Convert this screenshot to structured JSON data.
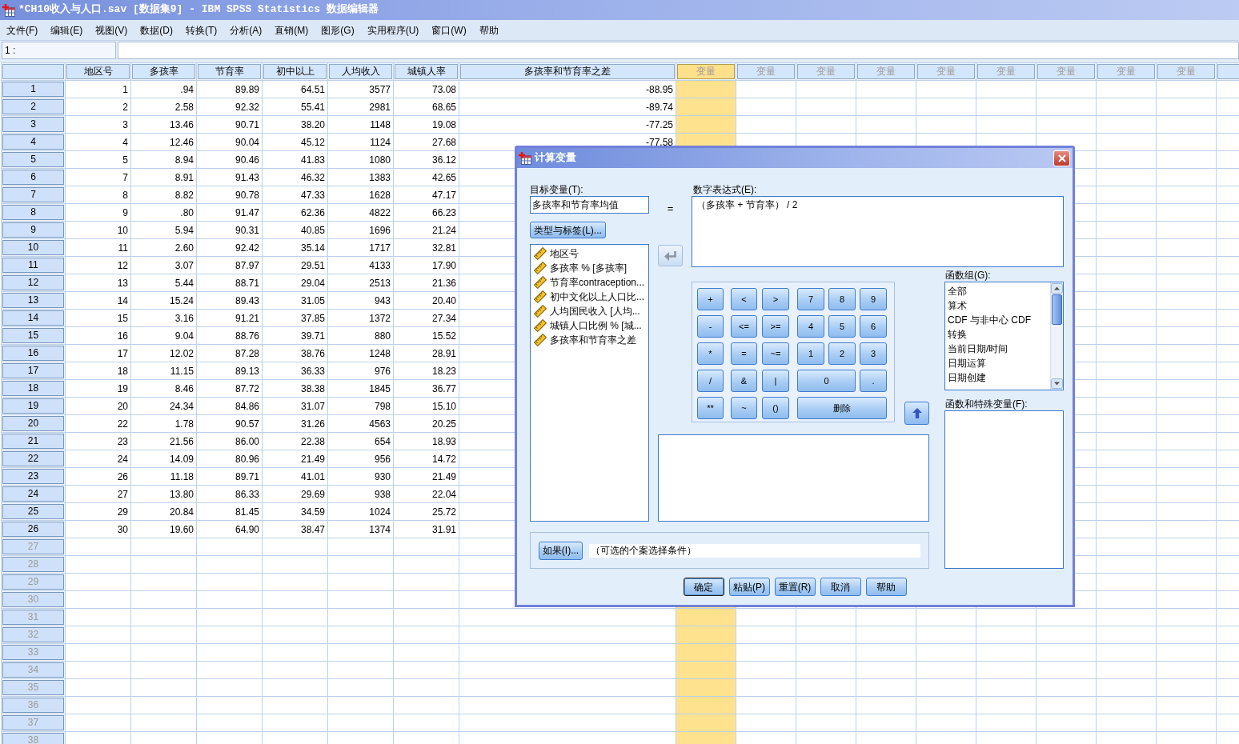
{
  "window": {
    "title": "*CH10收入与人口.sav [数据集9] - IBM SPSS Statistics 数据编辑器"
  },
  "menu": [
    "文件(F)",
    "编辑(E)",
    "视图(V)",
    "数据(D)",
    "转换(T)",
    "分析(A)",
    "直销(M)",
    "图形(G)",
    "实用程序(U)",
    "窗口(W)",
    "帮助"
  ],
  "cell_editor": {
    "reference": "1 :"
  },
  "grid": {
    "columns": [
      {
        "label": "地区号",
        "kind": "variable",
        "selected": false
      },
      {
        "label": "多孩率",
        "kind": "variable",
        "selected": false
      },
      {
        "label": "节育率",
        "kind": "variable",
        "selected": false
      },
      {
        "label": "初中以上",
        "kind": "variable",
        "selected": false
      },
      {
        "label": "人均收入",
        "kind": "variable",
        "selected": false
      },
      {
        "label": "城镇人率",
        "kind": "variable",
        "selected": false
      },
      {
        "label": "多孩率和节育率之差",
        "kind": "variable",
        "selected": false
      },
      {
        "label": "变量",
        "kind": "empty",
        "selected": true
      },
      {
        "label": "变量",
        "kind": "empty",
        "selected": false
      },
      {
        "label": "变量",
        "kind": "empty",
        "selected": false
      },
      {
        "label": "变量",
        "kind": "empty",
        "selected": false
      },
      {
        "label": "变量",
        "kind": "empty",
        "selected": false
      },
      {
        "label": "变量",
        "kind": "empty",
        "selected": false
      },
      {
        "label": "变量",
        "kind": "empty",
        "selected": false
      },
      {
        "label": "变量",
        "kind": "empty",
        "selected": false
      },
      {
        "label": "变量",
        "kind": "empty",
        "selected": false
      },
      {
        "kind": "empty",
        "selected": false
      }
    ],
    "rows": [
      {
        "number": "1",
        "cells": [
          "1",
          ".94",
          "89.89",
          "64.51",
          "3577",
          "73.08",
          "-88.95"
        ]
      },
      {
        "number": "2",
        "cells": [
          "2",
          "2.58",
          "92.32",
          "55.41",
          "2981",
          "68.65",
          "-89.74"
        ]
      },
      {
        "number": "3",
        "cells": [
          "3",
          "13.46",
          "90.71",
          "38.20",
          "1148",
          "19.08",
          "-77.25"
        ]
      },
      {
        "number": "4",
        "cells": [
          "4",
          "12.46",
          "90.04",
          "45.12",
          "1124",
          "27.68",
          "-77.58"
        ]
      },
      {
        "number": "5",
        "cells": [
          "5",
          "8.94",
          "90.46",
          "41.83",
          "1080",
          "36.12"
        ]
      },
      {
        "number": "6",
        "cells": [
          "7",
          "8.91",
          "91.43",
          "46.32",
          "1383",
          "42.65"
        ]
      },
      {
        "number": "7",
        "cells": [
          "8",
          "8.82",
          "90.78",
          "47.33",
          "1628",
          "47.17"
        ]
      },
      {
        "number": "8",
        "cells": [
          "9",
          ".80",
          "91.47",
          "62.36",
          "4822",
          "66.23"
        ]
      },
      {
        "number": "9",
        "cells": [
          "10",
          "5.94",
          "90.31",
          "40.85",
          "1696",
          "21.24"
        ]
      },
      {
        "number": "10",
        "cells": [
          "11",
          "2.60",
          "92.42",
          "35.14",
          "1717",
          "32.81"
        ]
      },
      {
        "number": "11",
        "cells": [
          "12",
          "3.07",
          "87.97",
          "29.51",
          "4133",
          "17.90"
        ]
      },
      {
        "number": "12",
        "cells": [
          "13",
          "5.44",
          "88.71",
          "29.04",
          "2513",
          "21.36"
        ]
      },
      {
        "number": "13",
        "cells": [
          "14",
          "15.24",
          "89.43",
          "31.05",
          "943",
          "20.40"
        ]
      },
      {
        "number": "14",
        "cells": [
          "15",
          "3.16",
          "91.21",
          "37.85",
          "1372",
          "27.34"
        ]
      },
      {
        "number": "15",
        "cells": [
          "16",
          "9.04",
          "88.76",
          "39.71",
          "880",
          "15.52"
        ]
      },
      {
        "number": "16",
        "cells": [
          "17",
          "12.02",
          "87.28",
          "38.76",
          "1248",
          "28.91"
        ]
      },
      {
        "number": "17",
        "cells": [
          "18",
          "11.15",
          "89.13",
          "36.33",
          "976",
          "18.23"
        ]
      },
      {
        "number": "18",
        "cells": [
          "19",
          "8.46",
          "87.72",
          "38.38",
          "1845",
          "36.77"
        ]
      },
      {
        "number": "19",
        "cells": [
          "20",
          "24.34",
          "84.86",
          "31.07",
          "798",
          "15.10"
        ]
      },
      {
        "number": "20",
        "cells": [
          "22",
          "1.78",
          "90.57",
          "31.26",
          "4563",
          "20.25"
        ]
      },
      {
        "number": "21",
        "cells": [
          "23",
          "21.56",
          "86.00",
          "22.38",
          "654",
          "18.93"
        ]
      },
      {
        "number": "22",
        "cells": [
          "24",
          "14.09",
          "80.96",
          "21.49",
          "956",
          "14.72"
        ]
      },
      {
        "number": "23",
        "cells": [
          "26",
          "11.18",
          "89.71",
          "41.01",
          "930",
          "21.49"
        ]
      },
      {
        "number": "24",
        "cells": [
          "27",
          "13.80",
          "86.33",
          "29.69",
          "938",
          "22.04"
        ]
      },
      {
        "number": "25",
        "cells": [
          "29",
          "20.84",
          "81.45",
          "34.59",
          "1024",
          "25.72"
        ]
      },
      {
        "number": "26",
        "cells": [
          "30",
          "19.60",
          "64.90",
          "38.47",
          "1374",
          "31.91"
        ]
      },
      {
        "number": "27",
        "cells": []
      },
      {
        "number": "28",
        "cells": []
      },
      {
        "number": "29",
        "cells": []
      },
      {
        "number": "30",
        "cells": []
      },
      {
        "number": "31",
        "cells": []
      },
      {
        "number": "32",
        "cells": []
      },
      {
        "number": "33",
        "cells": []
      },
      {
        "number": "34",
        "cells": []
      },
      {
        "number": "35",
        "cells": []
      },
      {
        "number": "36",
        "cells": []
      },
      {
        "number": "37",
        "cells": []
      },
      {
        "number": "38",
        "cells": []
      }
    ]
  },
  "dialog": {
    "title": "计算变量",
    "target": {
      "label": "目标变量(T):",
      "value": "多孩率和节育率均值"
    },
    "equals_sign": "=",
    "type_label_button": "类型与标签(L)...",
    "variables": [
      "地区号",
      "多孩率 % [多孩率]",
      "节育率contraception...",
      "初中文化以上人口比...",
      "人均国民收入 [人均...",
      "城镇人口比例 % [城...",
      "多孩率和节育率之差"
    ],
    "move_button": {
      "disabled": true
    },
    "expression": {
      "label": "数字表达式(E):",
      "value": "（多孩率 + 节育率） / 2"
    },
    "keypad": [
      [
        {
          "label": "+",
          "kind": "single"
        },
        {
          "label": "<",
          "kind": "single"
        },
        {
          "label": ">",
          "kind": "single"
        },
        {
          "label": "7",
          "kind": "single"
        },
        {
          "label": "8",
          "kind": "single"
        },
        {
          "label": "9",
          "kind": "single"
        }
      ],
      [
        {
          "label": "-",
          "kind": "single"
        },
        {
          "label": "<=",
          "kind": "single"
        },
        {
          "label": ">=",
          "kind": "single"
        },
        {
          "label": "4",
          "kind": "single"
        },
        {
          "label": "5",
          "kind": "single"
        },
        {
          "label": "6",
          "kind": "single"
        }
      ],
      [
        {
          "label": "*",
          "kind": "single"
        },
        {
          "label": "=",
          "kind": "single"
        },
        {
          "label": "~=",
          "kind": "single"
        },
        {
          "label": "1",
          "kind": "single"
        },
        {
          "label": "2",
          "kind": "single"
        },
        {
          "label": "3",
          "kind": "single"
        }
      ],
      [
        {
          "label": "/",
          "kind": "single"
        },
        {
          "label": "&",
          "kind": "single"
        },
        {
          "label": "|",
          "kind": "single"
        },
        {
          "label": "0",
          "kind": "double"
        },
        {
          "label": ".",
          "kind": "single"
        }
      ],
      [
        {
          "label": "**",
          "kind": "single"
        },
        {
          "label": "~",
          "kind": "single"
        },
        {
          "label": "()",
          "kind": "single"
        },
        {
          "label": "删除",
          "kind": "triple"
        }
      ]
    ],
    "insert_button": {
      "disabled": false
    },
    "function_groups": {
      "label": "函数组(G):",
      "items": [
        "全部",
        "算术",
        "CDF 与非中心 CDF",
        "转换",
        "当前日期/时间",
        "日期运算",
        "日期创建"
      ]
    },
    "functions": {
      "label": "函数和特殊变量(F):"
    },
    "if_button": "如果(I)...",
    "if_condition": "（可选的个案选择条件）",
    "buttons": [
      {
        "label": "确定",
        "default": true
      },
      {
        "label": "粘贴(P)",
        "default": false
      },
      {
        "label": "重置(R)",
        "default": false
      },
      {
        "label": "取消",
        "default": false
      },
      {
        "label": "帮助",
        "default": false
      }
    ]
  }
}
